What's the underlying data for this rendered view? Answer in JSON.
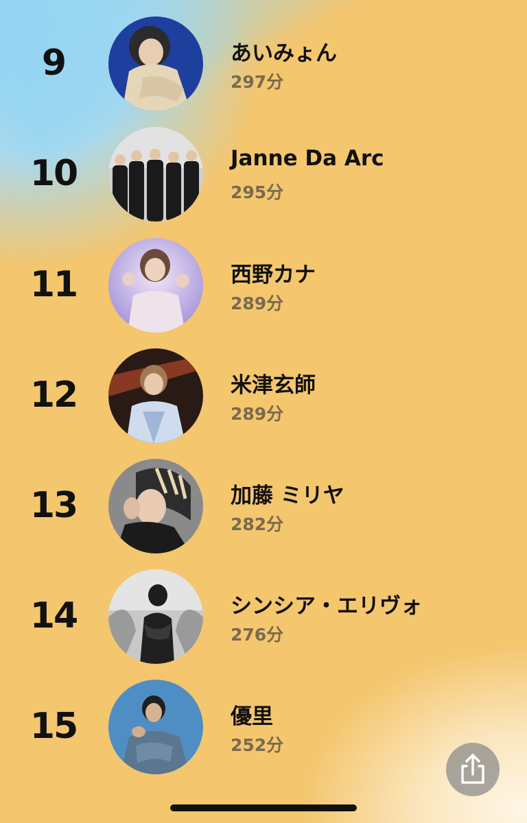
{
  "ranking": [
    {
      "rank": "9",
      "name": "あいみょん",
      "minutes": "297分",
      "icon": "artist-photo-icon"
    },
    {
      "rank": "10",
      "name": "Janne Da Arc",
      "minutes": "295分",
      "icon": "artist-photo-icon"
    },
    {
      "rank": "11",
      "name": "西野カナ",
      "minutes": "289分",
      "icon": "artist-photo-icon"
    },
    {
      "rank": "12",
      "name": "米津玄師",
      "minutes": "289分",
      "icon": "artist-photo-icon"
    },
    {
      "rank": "13",
      "name": "加藤 ミリヤ",
      "minutes": "282分",
      "icon": "artist-photo-icon"
    },
    {
      "rank": "14",
      "name": "シンシア・エリヴォ",
      "minutes": "276分",
      "icon": "artist-photo-icon"
    },
    {
      "rank": "15",
      "name": "優里",
      "minutes": "252分",
      "icon": "artist-photo-icon"
    }
  ],
  "share_button": {
    "icon": "share-icon"
  },
  "colors": {
    "background": "#f4c66e",
    "accent_blue": "#8fd6f8",
    "text": "#111111",
    "minutes_text": "#7a6a4e"
  }
}
